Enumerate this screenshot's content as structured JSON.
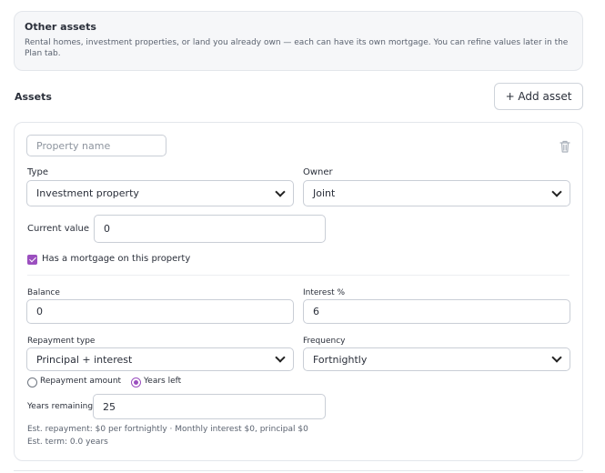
{
  "info": {
    "title": "Other assets",
    "description": "Rental homes, investment properties, or land you already own — each can have its own mortgage. You can refine values later in the Plan tab."
  },
  "assets": {
    "section_title": "Assets",
    "add_button": "+ Add asset"
  },
  "asset": {
    "name_placeholder": "Property name",
    "name_value": "",
    "type_label": "Type",
    "type_value": "Investment property",
    "owner_label": "Owner",
    "owner_value": "Joint",
    "current_value_label": "Current value",
    "current_value": "0",
    "has_mortgage_label": "Has a mortgage on this property",
    "has_mortgage": true,
    "balance_label": "Balance",
    "balance_value": "0",
    "interest_label": "Interest %",
    "interest_value": "6",
    "repayment_type_label": "Repayment type",
    "repayment_type_value": "Principal + interest",
    "frequency_label": "Frequency",
    "frequency_value": "Fortnightly",
    "radio_repayment_amount": "Repayment amount",
    "radio_years_left": "Years left",
    "years_remaining_label": "Years remaining",
    "years_remaining_value": "25",
    "estimate_line1": "Est. repayment: $0 per fortnightly · Monthly interest $0, principal $0",
    "estimate_line2": "Est. term: 0.0 years"
  },
  "colors": {
    "accent": "#9b4fbf",
    "border": "#c9ced6",
    "info_bg": "#f6f7f9"
  },
  "icons": {
    "delete": "trash-icon",
    "dropdown": "chevron-down-icon"
  }
}
